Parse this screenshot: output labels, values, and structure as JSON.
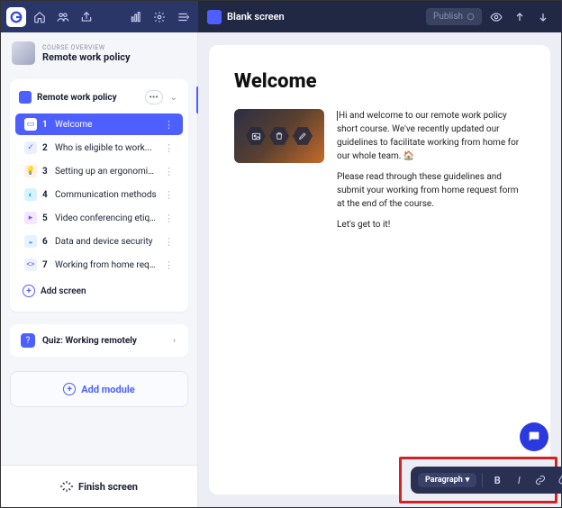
{
  "topbar": {
    "screen_label": "Blank screen",
    "publish_label": "Publish"
  },
  "course": {
    "overview_label": "COURSE OVERVIEW",
    "title": "Remote work policy"
  },
  "module": {
    "title": "Remote work policy",
    "screens": [
      {
        "num": "1",
        "label": "Welcome"
      },
      {
        "num": "2",
        "label": "Who is eligible to work..."
      },
      {
        "num": "3",
        "label": "Setting up an ergonomic..."
      },
      {
        "num": "4",
        "label": "Communication methods"
      },
      {
        "num": "5",
        "label": "Video conferencing etiquette"
      },
      {
        "num": "6",
        "label": "Data and device security"
      },
      {
        "num": "7",
        "label": "Working from home request..."
      }
    ],
    "add_screen_label": "Add screen"
  },
  "quiz": {
    "title": "Quiz: Working remotely"
  },
  "add_module_label": "Add module",
  "finish_label": "Finish screen",
  "content": {
    "heading": "Welcome",
    "p1": "Hi and welcome to our remote work policy short course. We've recently updated our guidelines to facilitate working from home for our whole team. 🏠",
    "p2": "Please read through these guidelines and submit your working from home request form at the end of the course.",
    "p3": "Let's get to it!"
  },
  "toolbar": {
    "style_label": "Paragraph"
  }
}
